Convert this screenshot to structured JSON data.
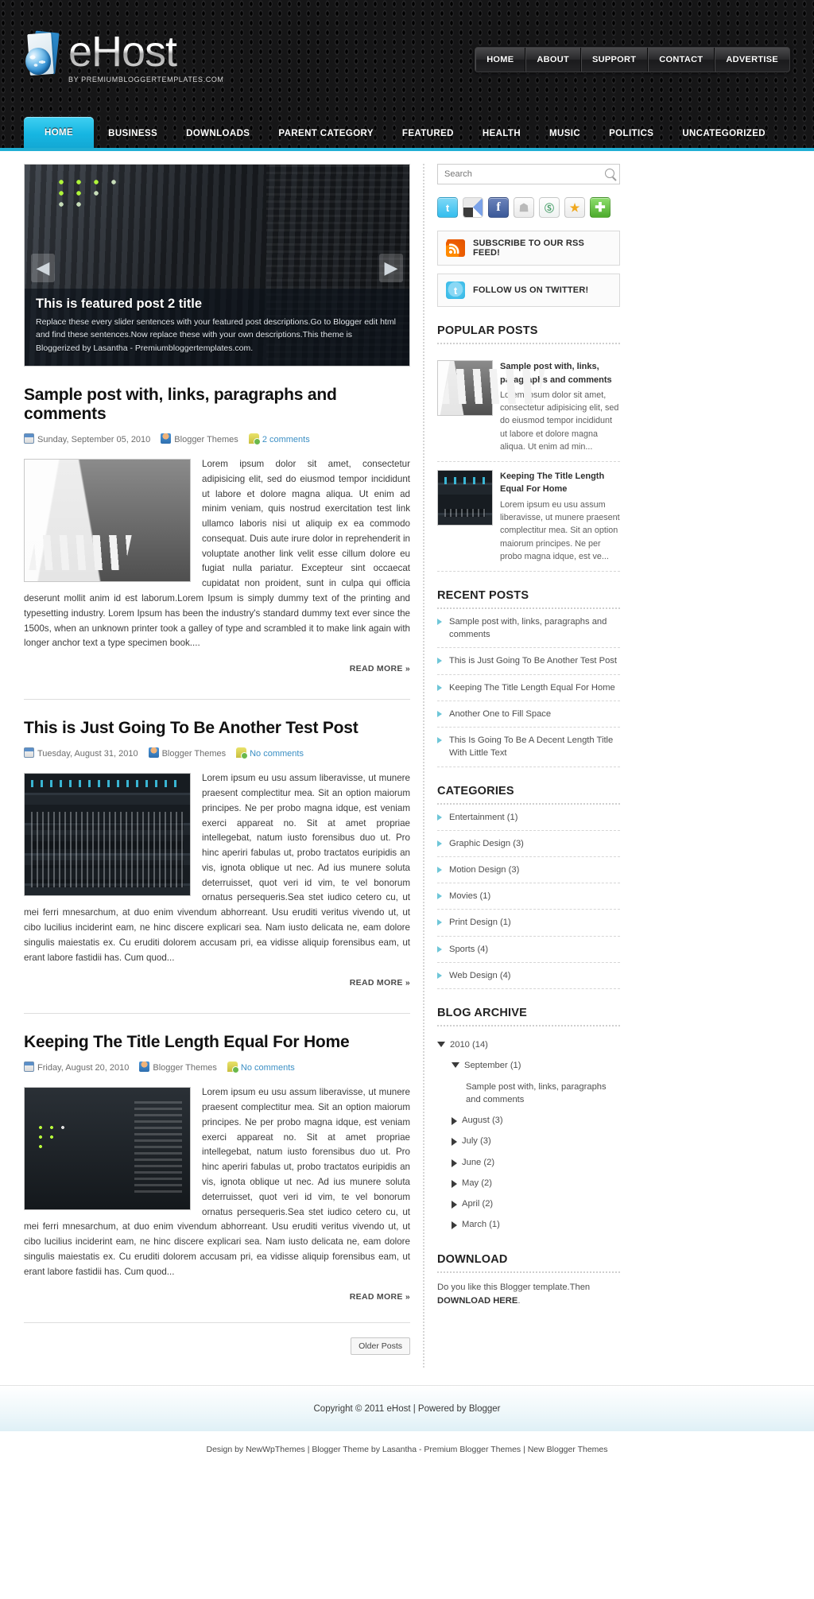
{
  "header": {
    "logo_title": "eHost",
    "logo_sub": "BY PREMIUMBLOGGERTEMPLATES.COM",
    "top_nav": [
      {
        "label": "HOME"
      },
      {
        "label": "ABOUT"
      },
      {
        "label": "SUPPORT"
      },
      {
        "label": "CONTACT"
      },
      {
        "label": "ADVERTISE"
      }
    ],
    "main_nav": [
      {
        "label": "HOME",
        "active": true
      },
      {
        "label": "BUSINESS",
        "active": false
      },
      {
        "label": "DOWNLOADS",
        "active": false
      },
      {
        "label": "PARENT CATEGORY",
        "active": false
      },
      {
        "label": "FEATURED",
        "active": false
      },
      {
        "label": "HEALTH",
        "active": false
      },
      {
        "label": "MUSIC",
        "active": false
      },
      {
        "label": "POLITICS",
        "active": false
      },
      {
        "label": "UNCATEGORIZED",
        "active": false
      }
    ],
    "accent_color": "#21afd4"
  },
  "slider": {
    "title": "This is featured post 2 title",
    "description": "Replace these every slider sentences with your featured post descriptions.Go to Blogger edit html and find these sentences.Now replace these with your own descriptions.This theme is Bloggerized by Lasantha - Premiumbloggertemplates.com.",
    "prev_label": "◀",
    "next_label": "▶"
  },
  "posts": [
    {
      "title": "Sample post with, links, paragraphs and comments",
      "date": "Sunday, September 05, 2010",
      "author": "Blogger Themes",
      "comments": "2 comments",
      "body": "Lorem ipsum dolor sit amet, consectetur adipisicing elit, sed do eiusmod tempor incididunt ut labore et dolore magna aliqua. Ut enim ad minim veniam, quis nostrud exercitation test link ullamco laboris nisi ut aliquip ex ea commodo consequat. Duis aute irure dolor in reprehenderit in voluptate another link velit esse cillum dolore eu fugiat nulla pariatur. Excepteur sint occaecat cupidatat non proident, sunt in culpa qui officia deserunt mollit anim id est laborum.Lorem Ipsum is simply dummy text of the printing and typesetting industry. Lorem Ipsum has been the industry's standard dummy text ever since the 1500s, when an unknown printer took a galley of type and scrambled it to make link again with longer anchor text a type specimen book....",
      "read_more": "READ MORE »",
      "thumb_kind": "road"
    },
    {
      "title": "This is Just Going To Be Another Test Post",
      "date": "Tuesday, August 31, 2010",
      "author": "Blogger Themes",
      "comments": "No comments",
      "body": "Lorem ipsum eu usu assum liberavisse, ut munere praesent complectitur mea. Sit an option maiorum principes. Ne per probo magna idque, est veniam exerci appareat no. Sit at amet propriae intellegebat, natum iusto forensibus duo ut. Pro hinc aperiri fabulas ut, probo tractatos euripidis an vis, ignota oblique ut nec. Ad ius munere soluta deterruisset, quot veri id vim, te vel bonorum ornatus persequeris.Sea stet iudico cetero cu, ut mei ferri mnesarchum, at duo enim vivendum abhorreant. Usu eruditi veritus vivendo ut, ut cibo lucilius inciderint eam, ne hinc discere explicari sea. Nam iusto delicata ne, eam dolore singulis maiestatis ex. Cu eruditi dolorem accusam pri, ea vidisse aliquip forensibus eam, ut erant labore fastidii has. Cum quod...",
      "read_more": "READ MORE »",
      "thumb_kind": "rack"
    },
    {
      "title": "Keeping The Title Length Equal For Home",
      "date": "Friday, August 20, 2010",
      "author": "Blogger Themes",
      "comments": "No comments",
      "body": "Lorem ipsum eu usu assum liberavisse, ut munere praesent complectitur mea. Sit an option maiorum principes. Ne per probo magna idque, est veniam exerci appareat no. Sit at amet propriae intellegebat, natum iusto forensibus duo ut. Pro hinc aperiri fabulas ut, probo tractatos euripidis an vis, ignota oblique ut nec. Ad ius munere soluta deterruisset, quot veri id vim, te vel bonorum ornatus persequeris.Sea stet iudico cetero cu, ut mei ferri mnesarchum, at duo enim vivendum abhorreant. Usu eruditi veritus vivendo ut, ut cibo lucilius inciderint eam, ne hinc discere explicari sea. Nam iusto delicata ne, eam dolore singulis maiestatis ex. Cu eruditi dolorem accusam pri, ea vidisse aliquip forensibus eam, ut erant labore fastidii has. Cum quod...",
      "read_more": "READ MORE »",
      "thumb_kind": "usb"
    }
  ],
  "pager": {
    "older_posts": "Older Posts"
  },
  "sidebar": {
    "search": {
      "placeholder": "Search",
      "value": "",
      "icon": "search-icon"
    },
    "social": [
      {
        "name": "twitter-icon",
        "glyph": "t"
      },
      {
        "name": "delicious-icon",
        "glyph": ""
      },
      {
        "name": "facebook-icon",
        "glyph": "f"
      },
      {
        "name": "technorati-icon",
        "glyph": "☗"
      },
      {
        "name": "stumbleupon-icon",
        "glyph": "Ⓢ"
      },
      {
        "name": "favorites-icon",
        "glyph": "★"
      },
      {
        "name": "share-icon",
        "glyph": "✚"
      }
    ],
    "rss_box": {
      "label": "SUBSCRIBE TO OUR RSS FEED!",
      "icon": "rss-icon"
    },
    "twitter_box": {
      "label": "FOLLOW US ON TWITTER!",
      "icon": "twitter-bird-icon"
    },
    "popular_posts": {
      "title": "POPULAR POSTS",
      "items": [
        {
          "title": "Sample post with, links, paragraphs and comments",
          "excerpt": "Lorem ipsum dolor sit amet, consectetur adipisicing elit, sed do eiusmod tempor incididunt ut labore et dolore magna aliqua. Ut enim ad min...",
          "thumb_kind": "road"
        },
        {
          "title": "Keeping The Title Length Equal For Home",
          "excerpt": "Lorem ipsum eu usu assum liberavisse, ut munere praesent complectitur mea. Sit an option maiorum principes. Ne per probo magna idque, est ve...",
          "thumb_kind": "rack"
        }
      ]
    },
    "recent_posts": {
      "title": "RECENT POSTS",
      "items": [
        "Sample post with, links, paragraphs and comments",
        "This is Just Going To Be Another Test Post",
        "Keeping The Title Length Equal For Home",
        "Another One to Fill Space",
        "This Is Going To Be A Decent Length Title With Little Text"
      ]
    },
    "categories": {
      "title": "CATEGORIES",
      "items": [
        "Entertainment (1)",
        "Graphic Design (3)",
        "Motion Design (3)",
        "Movies (1)",
        "Print Design (1)",
        "Sports (4)",
        "Web Design (4)"
      ]
    },
    "blog_archive": {
      "title": "BLOG ARCHIVE",
      "items": [
        {
          "label": "2010 (14)",
          "level": 1,
          "state": "expanded"
        },
        {
          "label": "September (1)",
          "level": 2,
          "state": "expanded"
        },
        {
          "label": "Sample post with, links, paragraphs and comments",
          "level": 3,
          "state": "leaf"
        },
        {
          "label": "August (3)",
          "level": 2,
          "state": "collapsed"
        },
        {
          "label": "July (3)",
          "level": 2,
          "state": "collapsed"
        },
        {
          "label": "June (2)",
          "level": 2,
          "state": "collapsed"
        },
        {
          "label": "May (2)",
          "level": 2,
          "state": "collapsed"
        },
        {
          "label": "April (2)",
          "level": 2,
          "state": "collapsed"
        },
        {
          "label": "March (1)",
          "level": 2,
          "state": "collapsed"
        }
      ]
    },
    "download": {
      "title": "DOWNLOAD",
      "text_before": "Do you like this Blogger template.Then ",
      "link_label": "DOWNLOAD HERE",
      "text_after": "."
    }
  },
  "footer": {
    "copyright": "Copyright © 2011 eHost | Powered by Blogger",
    "credits": "Design by NewWpThemes | Blogger Theme by Lasantha - Premium Blogger Themes | New Blogger Themes"
  }
}
